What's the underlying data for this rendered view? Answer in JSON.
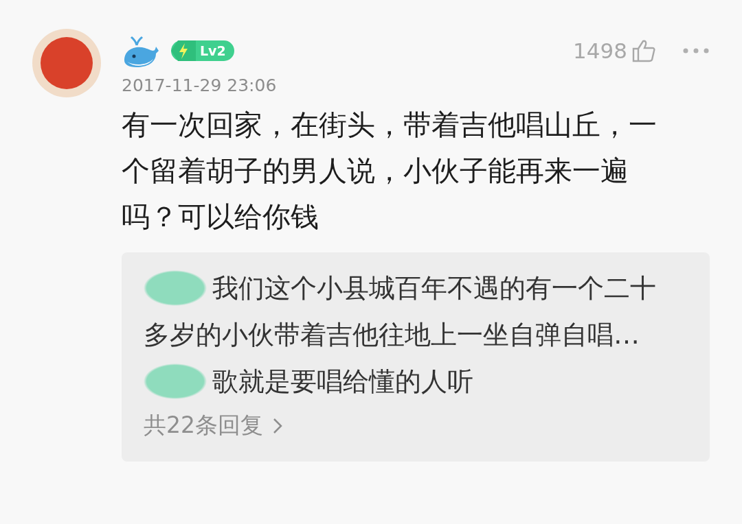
{
  "comment": {
    "level_badge": "Lv2",
    "date": "2017-11-29 23:06",
    "likes": "1498",
    "text": "有一次回家，在街头，带着吉他唱山丘，一个留着胡子的男人说，小伙子能再来一遍吗？可以给你钱",
    "replies": [
      {
        "text": "我们这个小县城百年不遇的有一个二十多岁的小伙带着吉他往地上一坐自弹自唱…"
      },
      {
        "text": "歌就是要唱给懂的人听"
      }
    ],
    "reply_count": "共22条回复"
  }
}
